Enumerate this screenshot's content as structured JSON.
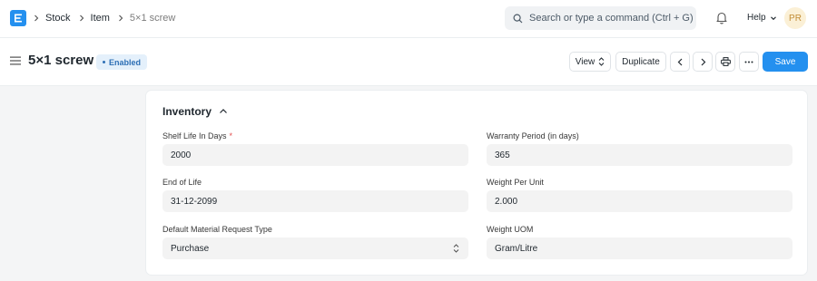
{
  "navbar": {
    "logo_icon": "erpnext-logo-icon",
    "breadcrumbs": [
      "Stock",
      "Item",
      "5×1 screw"
    ],
    "search_placeholder": "Search or type a command (Ctrl + G)",
    "help_label": "Help",
    "avatar_initials": "PR"
  },
  "page": {
    "title": "5×1 screw",
    "status": "Enabled",
    "view_label": "View",
    "duplicate_label": "Duplicate",
    "save_label": "Save"
  },
  "section": {
    "title": "Inventory",
    "fields": {
      "shelf_life": {
        "label": "Shelf Life In Days",
        "required_mark": "*",
        "value": "2000"
      },
      "end_of_life": {
        "label": "End of Life",
        "value": "31-12-2099"
      },
      "material_request_type": {
        "label": "Default Material Request Type",
        "value": "Purchase"
      },
      "warranty_period": {
        "label": "Warranty Period (in days)",
        "value": "365"
      },
      "weight_per_unit": {
        "label": "Weight Per Unit",
        "value": "2.000"
      },
      "weight_uom": {
        "label": "Weight UOM",
        "value": "Gram/Litre"
      }
    }
  },
  "colors": {
    "accent": "#2490ef",
    "badge_bg": "#e4f0fb",
    "badge_text": "#2d6fb5",
    "required": "#e24c4c"
  }
}
